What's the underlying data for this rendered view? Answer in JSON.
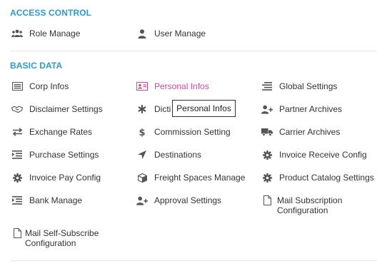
{
  "sections": {
    "access_control": {
      "title": "ACCESS CONTROL",
      "items": [
        {
          "label": "Role Manage",
          "icon": "users-icon"
        },
        {
          "label": "User Manage",
          "icon": "user-icon"
        }
      ]
    },
    "basic_data": {
      "title": "BASIC DATA",
      "items": [
        {
          "label": "Corp Infos",
          "icon": "list-icon"
        },
        {
          "label": "Personal Infos",
          "icon": "id-card-icon",
          "active": true
        },
        {
          "label": "Global Settings",
          "icon": "align-icon"
        },
        {
          "label": "Disclaimer Settings",
          "icon": "handshake-icon"
        },
        {
          "label": "Dicti",
          "icon": "asterisk-icon"
        },
        {
          "label": "Partner Archives",
          "icon": "user-plus-icon"
        },
        {
          "label": "Exchange Rates",
          "icon": "exchange-icon"
        },
        {
          "label": "Commission Setting",
          "icon": "dollar-icon"
        },
        {
          "label": "Carrier Archives",
          "icon": "truck-icon"
        },
        {
          "label": "Purchase Settings",
          "icon": "indent-icon"
        },
        {
          "label": "Destinations",
          "icon": "location-arrow-icon"
        },
        {
          "label": "Invoice Receive Config",
          "icon": "gear-icon"
        },
        {
          "label": "Invoice Pay Config",
          "icon": "gear-icon"
        },
        {
          "label": "Freight Spaces Manage",
          "icon": "cube-icon"
        },
        {
          "label": "Product Catalog Settings",
          "icon": "gear-icon"
        },
        {
          "label": "Bank Manage",
          "icon": "indent-icon"
        },
        {
          "label": "Approval Settings",
          "icon": "user-plus-icon"
        },
        {
          "label": "Mail Subscription Configuration",
          "icon": "file-icon"
        },
        {
          "label": "Mail Self-Subscribe Configuration",
          "icon": "file-icon"
        }
      ]
    }
  },
  "tooltip": {
    "text": "Personal Infos"
  },
  "colors": {
    "section_title": "#2a9bd6",
    "active": "#d9479a",
    "text": "#333333"
  }
}
